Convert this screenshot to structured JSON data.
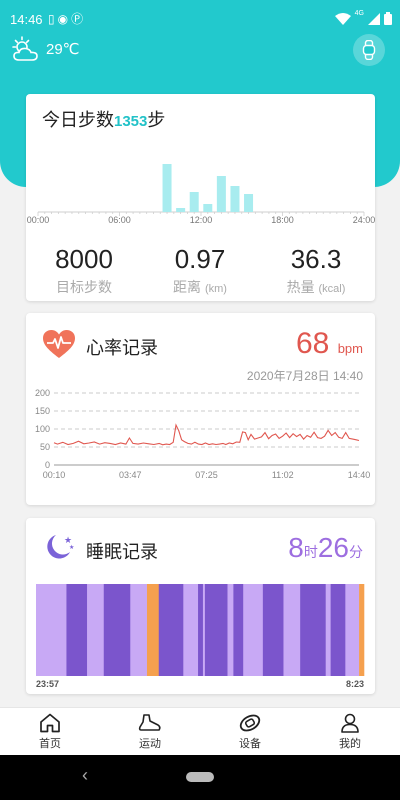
{
  "status": {
    "time": "14:46",
    "network": "4G"
  },
  "weather": {
    "temperature": "29℃"
  },
  "steps_card": {
    "title_prefix": "今日步数",
    "count": "1353",
    "title_suffix": "步",
    "metrics": [
      {
        "value": "8000",
        "label": "目标步数",
        "unit": ""
      },
      {
        "value": "0.97",
        "label": "距离",
        "unit": "(km)"
      },
      {
        "value": "36.3",
        "label": "热量",
        "unit": "(kcal)"
      }
    ]
  },
  "heart_card": {
    "title": "心率记录",
    "value": "68",
    "unit": "bpm",
    "date": "2020年7月28日 14:40"
  },
  "sleep_card": {
    "title": "睡眠记录",
    "hours": "8",
    "hours_unit": "时",
    "minutes": "26",
    "minutes_unit": "分",
    "start": "23:57",
    "end": "8:23"
  },
  "nav": [
    {
      "label": "首页",
      "icon": "home-icon"
    },
    {
      "label": "运动",
      "icon": "shoe-icon"
    },
    {
      "label": "设备",
      "icon": "band-icon"
    },
    {
      "label": "我的",
      "icon": "person-icon"
    }
  ],
  "colors": {
    "teal": "#22c9cd",
    "heart_red": "#e0574f",
    "sleep_purple": "#9d6ee0",
    "deep_sleep": "#7b55cc",
    "light_sleep": "#c8a9f5",
    "awake": "#f5a04e"
  },
  "chart_data": [
    {
      "type": "bar",
      "x_ticks": [
        "00:00",
        "06:00",
        "12:00",
        "18:00",
        "24:00"
      ],
      "x_range_hours": [
        0,
        24
      ],
      "bars": [
        {
          "hour": 9.5,
          "value": 48
        },
        {
          "hour": 10.5,
          "value": 4
        },
        {
          "hour": 11.5,
          "value": 20
        },
        {
          "hour": 12.5,
          "value": 8
        },
        {
          "hour": 13.5,
          "value": 36
        },
        {
          "hour": 14.5,
          "value": 26
        },
        {
          "hour": 15.5,
          "value": 18
        }
      ]
    },
    {
      "type": "line",
      "y_ticks": [
        0,
        50,
        100,
        150,
        200
      ],
      "ylim": [
        0,
        200
      ],
      "x_ticks": [
        "00:10",
        "03:47",
        "07:25",
        "11:02",
        "14:40"
      ],
      "x_range_minutes": [
        10,
        880
      ],
      "points": [
        [
          10,
          62
        ],
        [
          20,
          58
        ],
        [
          35,
          63
        ],
        [
          50,
          57
        ],
        [
          65,
          60
        ],
        [
          80,
          66
        ],
        [
          95,
          59
        ],
        [
          110,
          61
        ],
        [
          125,
          64
        ],
        [
          140,
          58
        ],
        [
          155,
          62
        ],
        [
          170,
          60
        ],
        [
          185,
          57
        ],
        [
          200,
          61
        ],
        [
          215,
          58
        ],
        [
          225,
          75
        ],
        [
          235,
          60
        ],
        [
          250,
          58
        ],
        [
          265,
          61
        ],
        [
          280,
          59
        ],
        [
          295,
          57
        ],
        [
          310,
          60
        ],
        [
          320,
          56
        ],
        [
          330,
          58
        ],
        [
          340,
          57
        ],
        [
          350,
          63
        ],
        [
          358,
          111
        ],
        [
          366,
          95
        ],
        [
          374,
          70
        ],
        [
          382,
          65
        ],
        [
          392,
          60
        ],
        [
          402,
          58
        ],
        [
          412,
          63
        ],
        [
          422,
          58
        ],
        [
          432,
          57
        ],
        [
          442,
          61
        ],
        [
          452,
          57
        ],
        [
          462,
          59
        ],
        [
          472,
          57
        ],
        [
          482,
          58
        ],
        [
          492,
          60
        ],
        [
          500,
          57
        ],
        [
          510,
          61
        ],
        [
          520,
          59
        ],
        [
          530,
          64
        ],
        [
          540,
          63
        ],
        [
          548,
          92
        ],
        [
          556,
          90
        ],
        [
          564,
          70
        ],
        [
          572,
          85
        ],
        [
          582,
          72
        ],
        [
          592,
          75
        ],
        [
          602,
          78
        ],
        [
          612,
          90
        ],
        [
          622,
          73
        ],
        [
          632,
          82
        ],
        [
          642,
          86
        ],
        [
          652,
          74
        ],
        [
          662,
          80
        ],
        [
          672,
          89
        ],
        [
          682,
          76
        ],
        [
          692,
          87
        ],
        [
          702,
          79
        ],
        [
          712,
          85
        ],
        [
          722,
          72
        ],
        [
          732,
          82
        ],
        [
          742,
          77
        ],
        [
          752,
          91
        ],
        [
          762,
          76
        ],
        [
          772,
          74
        ],
        [
          782,
          80
        ],
        [
          792,
          96
        ],
        [
          802,
          82
        ],
        [
          812,
          90
        ],
        [
          822,
          77
        ],
        [
          832,
          74
        ],
        [
          842,
          90
        ],
        [
          852,
          74
        ],
        [
          862,
          72
        ],
        [
          872,
          70
        ],
        [
          880,
          68
        ]
      ]
    },
    {
      "type": "bar",
      "subtype": "sleep-stages",
      "stages": [
        {
          "stage": "light",
          "dur": 31
        },
        {
          "stage": "deep",
          "dur": 21
        },
        {
          "stage": "light",
          "dur": 17
        },
        {
          "stage": "deep",
          "dur": 27
        },
        {
          "stage": "light",
          "dur": 17
        },
        {
          "stage": "awake",
          "dur": 12
        },
        {
          "stage": "deep",
          "dur": 25
        },
        {
          "stage": "light",
          "dur": 15
        },
        {
          "stage": "deep",
          "dur": 5
        },
        {
          "stage": "light",
          "dur": 2
        },
        {
          "stage": "deep",
          "dur": 23
        },
        {
          "stage": "light",
          "dur": 6
        },
        {
          "stage": "deep",
          "dur": 10
        },
        {
          "stage": "light",
          "dur": 20
        },
        {
          "stage": "deep",
          "dur": 21
        },
        {
          "stage": "light",
          "dur": 17
        },
        {
          "stage": "deep",
          "dur": 26
        },
        {
          "stage": "light",
          "dur": 5
        },
        {
          "stage": "deep",
          "dur": 15
        },
        {
          "stage": "light",
          "dur": 14
        },
        {
          "stage": "awake",
          "dur": 5
        }
      ]
    }
  ]
}
